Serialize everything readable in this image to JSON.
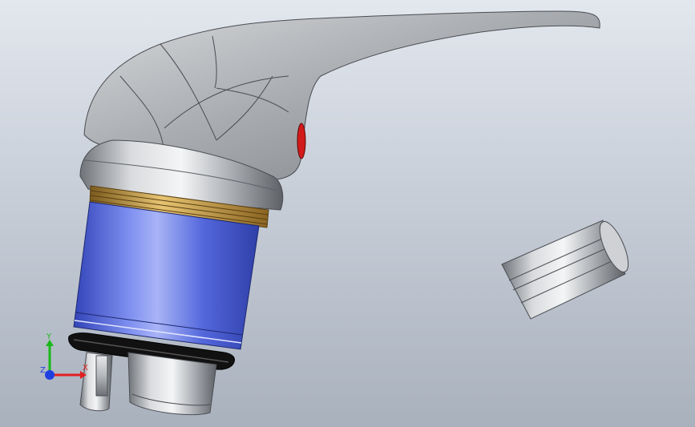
{
  "window": {
    "title": ""
  },
  "viewport": {
    "background_top": "#e3e7ee",
    "background_bottom": "#a9b1bd"
  },
  "model": {
    "parts": [
      {
        "name": "lever-handle",
        "color": "#b9bcc0"
      },
      {
        "name": "cartridge-cap",
        "color": "#c7c9cc"
      },
      {
        "name": "cartridge-thread",
        "color": "#c89a3a"
      },
      {
        "name": "cartridge-body",
        "color": "#4e63d8"
      },
      {
        "name": "o-ring",
        "color": "#111111"
      },
      {
        "name": "cartridge-stem",
        "color": "#bfc1c4"
      },
      {
        "name": "aerator-insert",
        "color": "#c3c5c8"
      }
    ],
    "indicator_color": "#d21a1a"
  },
  "triad": {
    "x_label": "X",
    "y_label": "Y",
    "z_label": "Z",
    "x_color": "#e02020",
    "y_color": "#18b818",
    "z_color": "#1f3fe0"
  }
}
